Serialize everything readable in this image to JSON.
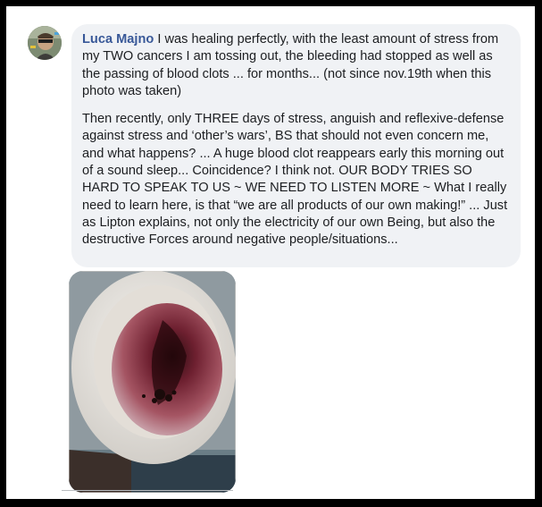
{
  "post": {
    "author": "Luca Majno",
    "paragraph1": "I was healing perfectly, with the least amount of stress from my TWO cancers I am tossing out, the bleeding had stopped as well as the passing of blood clots ... for months... (not since nov.19th when this photo was taken)",
    "paragraph2": "Then recently, only THREE days of stress, anguish and reflexive-defense against stress and ‘other’s wars’, BS that should not even concern me, and what happens? ... A huge blood clot reappears early this morning out of a sound sleep... Coincidence? I think not. OUR BODY TRIES SO HARD TO SPEAK TO US ~ WE NEED TO LISTEN MORE ~ What I really need to learn here, is that “we are all products of our own making!” ... Just as Lipton explains, not only the electricity of our own Being, but also the destructive Forces around negative people/situations..."
  },
  "colors": {
    "author_link": "#385898",
    "bubble_bg": "#f0f2f5",
    "text": "#1c1e21"
  }
}
